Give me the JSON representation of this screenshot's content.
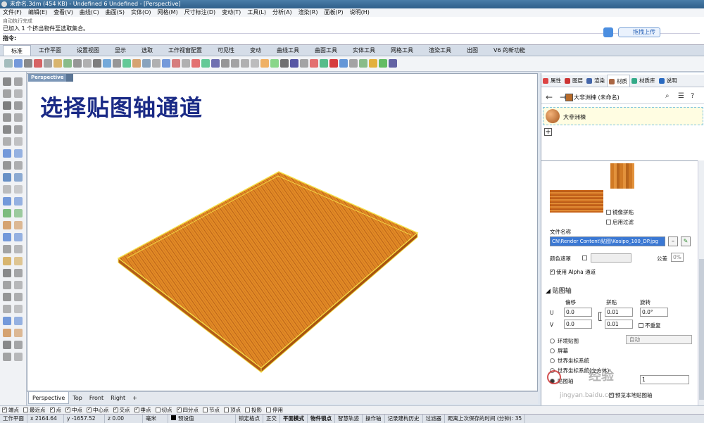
{
  "window": {
    "title": "未命名.3dm (454 KB) - Undefined 6 Undefined - [Perspective]"
  },
  "menu": [
    "文件(F)",
    "编辑(E)",
    "查看(V)",
    "曲线(C)",
    "曲面(S)",
    "实体(O)",
    "网格(M)",
    "尺寸标注(D)",
    "变动(T)",
    "工具(L)",
    "分析(A)",
    "渲染(R)",
    "面板(P)",
    "说明(H)"
  ],
  "command": {
    "history1": "自动执行完成",
    "history2": "已加入 1 个挤出物件至选取集合。",
    "prompt": "指令:",
    "upload_label": "拖拽上传"
  },
  "tabs": [
    "标准",
    "工作平面",
    "设置视图",
    "显示",
    "选取",
    "工作视窗配置",
    "可见性",
    "变动",
    "曲线工具",
    "曲面工具",
    "实体工具",
    "网格工具",
    "渲染工具",
    "出图",
    "V6 的新功能"
  ],
  "active_tab": "标准",
  "viewport": {
    "label": "Perspective",
    "overlay_title": "选择贴图轴通道"
  },
  "view_tabs": [
    "Perspective",
    "Top",
    "Front",
    "Right"
  ],
  "view_tabs_add": "+",
  "osnaps": [
    {
      "label": "端点",
      "checked": true
    },
    {
      "label": "最近点",
      "checked": false
    },
    {
      "label": "点",
      "checked": true
    },
    {
      "label": "中点",
      "checked": true
    },
    {
      "label": "中心点",
      "checked": true
    },
    {
      "label": "交点",
      "checked": true
    },
    {
      "label": "垂点",
      "checked": true
    },
    {
      "label": "切点",
      "checked": false
    },
    {
      "label": "四分点",
      "checked": true
    },
    {
      "label": "节点",
      "checked": false
    },
    {
      "label": "顶点",
      "checked": false
    },
    {
      "label": "投影",
      "checked": false
    },
    {
      "label": "停用",
      "checked": false
    }
  ],
  "status": {
    "cplane": "工作平面",
    "x": "x 2164.64",
    "y": "y -1657.52",
    "z": "z 0.00",
    "units": "毫米",
    "layer": "预设值",
    "items": [
      "锁定格点",
      "正交",
      "平面模式",
      "物件锁点",
      "智慧轨迹",
      "操作轴",
      "记录建构历史",
      "过滤器",
      "距离上次保存的时间 (分钟): 35"
    ]
  },
  "panel": {
    "tabs": [
      "属性",
      "图层",
      "渲染",
      "材质",
      "材质库",
      "说明"
    ],
    "active_tab": "材质",
    "breadcrumb": "大非洲楝 (未命名)",
    "material_name": "大非洲楝",
    "add_label": "+",
    "mirror_tile": "镜像拼贴",
    "enable_filter": "启用过滤",
    "filename_label": "文件名称",
    "filename_value": "CN\\Render Content\\贴图\\Kosipo_100_DP.jpg",
    "color_mask": "颜色遮罩",
    "tolerance_label": "公差",
    "tolerance_value": "0%",
    "use_alpha": "使用 Alpha 通道",
    "mapping_title": "贴图轴",
    "offset_label": "偏移",
    "tile_label": "拼贴",
    "rotate_label": "旋转",
    "u_label": "U",
    "v_label": "V",
    "u_offset": "0.0",
    "v_offset": "0.0",
    "u_tile": "0.01",
    "v_tile": "0.01",
    "rotation": "0.0°",
    "no_repeat": "不重复",
    "env_map": "环境贴图",
    "env_mode": "自动",
    "screen": "屏幕",
    "wcs": "世界坐标系统",
    "wcs2": "世界坐标系统(立方体)",
    "channel": "贴图轴",
    "channel_value": "1",
    "local_map": "预览本地贴图轴"
  },
  "watermark": {
    "text": "经验",
    "url": "jingyan.baidu.com"
  }
}
